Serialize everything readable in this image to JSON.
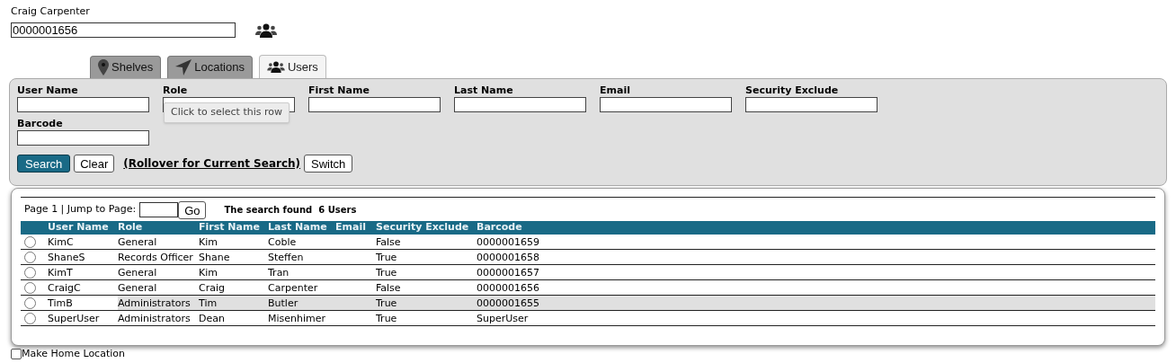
{
  "user": {
    "name": "Craig Carpenter",
    "barcode": "0000001656"
  },
  "tabs": [
    {
      "label": "Shelves",
      "kind": "pin",
      "selected": false
    },
    {
      "label": "Locations",
      "kind": "arrow",
      "selected": false
    },
    {
      "label": "Users",
      "kind": "users",
      "selected": true
    }
  ],
  "search_fields": [
    "User Name",
    "Role",
    "First Name",
    "Last Name",
    "Email",
    "Security Exclude",
    "Barcode"
  ],
  "tooltip": "Click to select this row",
  "buttons": {
    "search": "Search",
    "clear": "Clear",
    "rollover": "(Rollover for Current Search)",
    "switch": "Switch"
  },
  "pager": {
    "page": "Page 1 | Jump to Page:",
    "go": "Go",
    "found": "The search found  6 Users"
  },
  "table": {
    "columns": [
      "User Name",
      "Role",
      "First Name",
      "Last Name",
      "Email",
      "Security Exclude",
      "Barcode"
    ],
    "rows": [
      {
        "selected": false,
        "hovered": false,
        "cells": [
          "KimC",
          "General",
          "Kim",
          "Coble",
          "",
          "False",
          "0000001659"
        ]
      },
      {
        "selected": false,
        "hovered": false,
        "cells": [
          "ShaneS",
          "Records Officer",
          "Shane",
          "Steffen",
          "",
          "True",
          "0000001658"
        ]
      },
      {
        "selected": false,
        "hovered": false,
        "cells": [
          "KimT",
          "General",
          "Kim",
          "Tran",
          "",
          "True",
          "0000001657"
        ]
      },
      {
        "selected": false,
        "hovered": false,
        "cells": [
          "CraigC",
          "General",
          "Craig",
          "Carpenter",
          "",
          "False",
          "0000001656"
        ]
      },
      {
        "selected": false,
        "hovered": true,
        "cells": [
          "TimB",
          "Administrators",
          "Tim",
          "Butler",
          "",
          "True",
          "0000001655"
        ]
      },
      {
        "selected": false,
        "hovered": false,
        "cells": [
          "SuperUser",
          "Administrators",
          "Dean",
          "Misenhimer",
          "",
          "True",
          "SuperUser"
        ]
      }
    ]
  },
  "home_location": {
    "label": "Make Home Location",
    "checked": false
  }
}
